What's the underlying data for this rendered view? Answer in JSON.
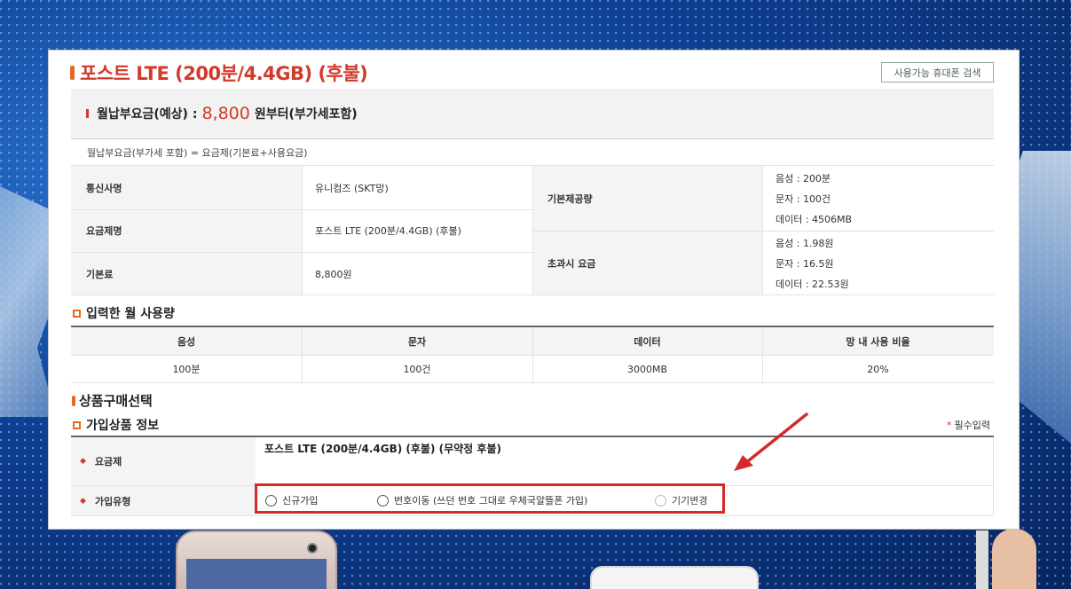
{
  "product": {
    "title": "포스트 LTE (200분/4.4GB) (후불)",
    "search_button": "사용가능 휴대폰 검색"
  },
  "fee": {
    "label": "월납부요금(예상) :",
    "amount": "8,800",
    "suffix": "원부터(부가세포함)",
    "formula": "월납부요금(부가세 포함) = 요금제(기본료+사용요금)"
  },
  "info": {
    "carrier_label": "통신사명",
    "carrier_value": "유니컴즈 (SKT망)",
    "plan_label": "요금제명",
    "plan_value": "포스트 LTE (200분/4.4GB) (후불)",
    "base_fee_label": "기본료",
    "base_fee_value": "8,800원",
    "provided_label": "기본제공량",
    "provided": [
      "음성 : 200분",
      "문자 : 100건",
      "데이터 : 4506MB"
    ],
    "overage_label": "초과시 요금",
    "overage": [
      "음성 : 1.98원",
      "문자 : 16.5원",
      "데이터 : 22.53원"
    ]
  },
  "usage": {
    "heading": "입력한 월 사용량",
    "headers": [
      "음성",
      "문자",
      "데이터",
      "망 내 사용 비율"
    ],
    "values": [
      "100분",
      "100건",
      "3000MB",
      "20%"
    ]
  },
  "purchase": {
    "heading": "상품구매선택",
    "subheading": "가입상품 정보",
    "required_note": "필수입력",
    "plan_label": "요금제",
    "plan_value": "포스트 LTE (200분/4.4GB) (후불) (무약정 후불)",
    "join_type_label": "가입유형",
    "options": [
      "신규가입",
      "번호이동 (쓰던 번호 그대로 우체국알뜰폰 가입)",
      "기기변경"
    ]
  },
  "colors": {
    "accent_red": "#d23a2a",
    "accent_orange": "#e36a1f",
    "highlight_box": "#d42a2a"
  }
}
